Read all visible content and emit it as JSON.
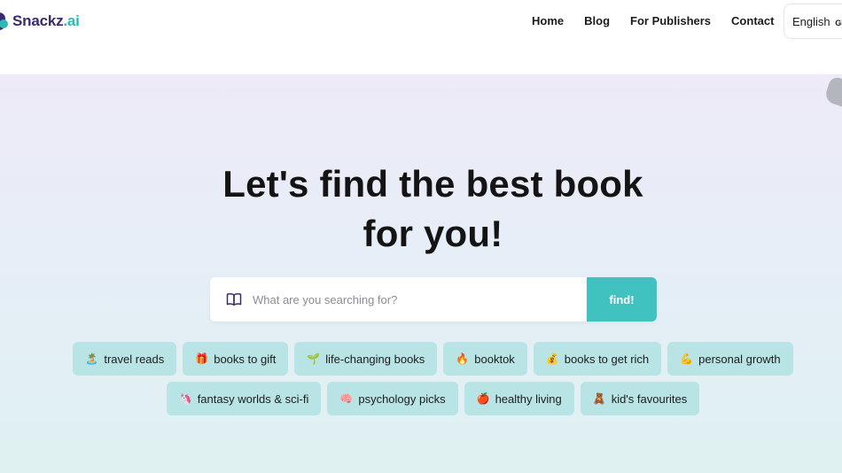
{
  "brand": {
    "name": "Snackz",
    "suffix": ".ai",
    "color_primary": "#3b2a6f",
    "color_accent": "#2fb9b4"
  },
  "nav": {
    "items": [
      {
        "label": "Home"
      },
      {
        "label": "Blog"
      },
      {
        "label": "For Publishers"
      },
      {
        "label": "Contact"
      }
    ],
    "language": {
      "label": "English",
      "code": "GE"
    }
  },
  "hero": {
    "title_line1": "Let's find the best book",
    "title_line2": "for you!",
    "search": {
      "placeholder": "What are you searching for?",
      "value": "",
      "icon": "book-icon",
      "button_label": "find!"
    },
    "button_color": "#3fc2c0",
    "chip_color": "#b8e4e6"
  },
  "chips": {
    "row1": [
      {
        "emoji": "🏝️",
        "label": "travel reads"
      },
      {
        "emoji": "🎁",
        "label": "books to gift"
      },
      {
        "emoji": "🌱",
        "label": "life-changing books"
      },
      {
        "emoji": "🔥",
        "label": "booktok"
      },
      {
        "emoji": "💰",
        "label": "books to get rich"
      },
      {
        "emoji": "💪",
        "label": "personal growth"
      }
    ],
    "row2": [
      {
        "emoji": "🦄",
        "label": "fantasy worlds & sci-fi"
      },
      {
        "emoji": "🧠",
        "label": "psychology picks"
      },
      {
        "emoji": "🍎",
        "label": "healthy living"
      },
      {
        "emoji": "🧸",
        "label": "kid's favourites"
      }
    ]
  }
}
